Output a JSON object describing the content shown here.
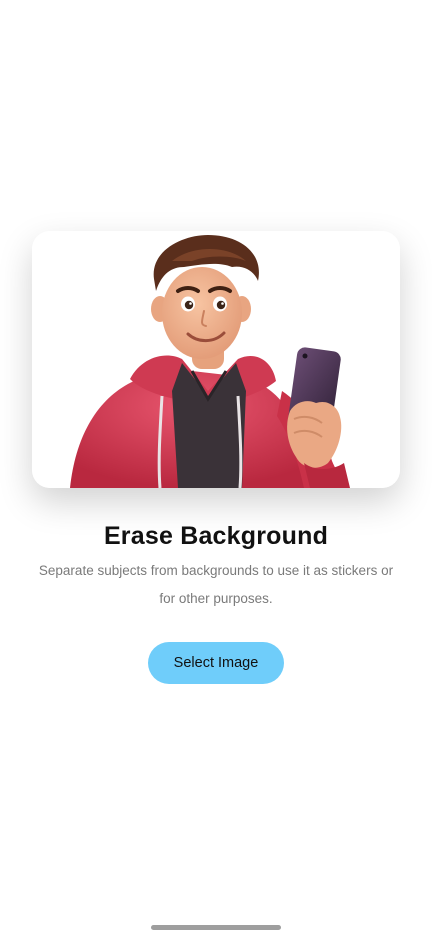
{
  "hero": {
    "image": "cartoon-boy-holding-phone",
    "colors": {
      "hoodie": "#d83a55",
      "skin": "#f0b08c",
      "hair": "#5a2e1c",
      "shirt": "#3a3238",
      "phone": "#4a3550"
    }
  },
  "content": {
    "title": "Erase Background",
    "subtitle": "Separate subjects from backgrounds to use it as stickers or for other purposes."
  },
  "actions": {
    "select_image_label": "Select Image",
    "accent": "#6fcdfa"
  }
}
